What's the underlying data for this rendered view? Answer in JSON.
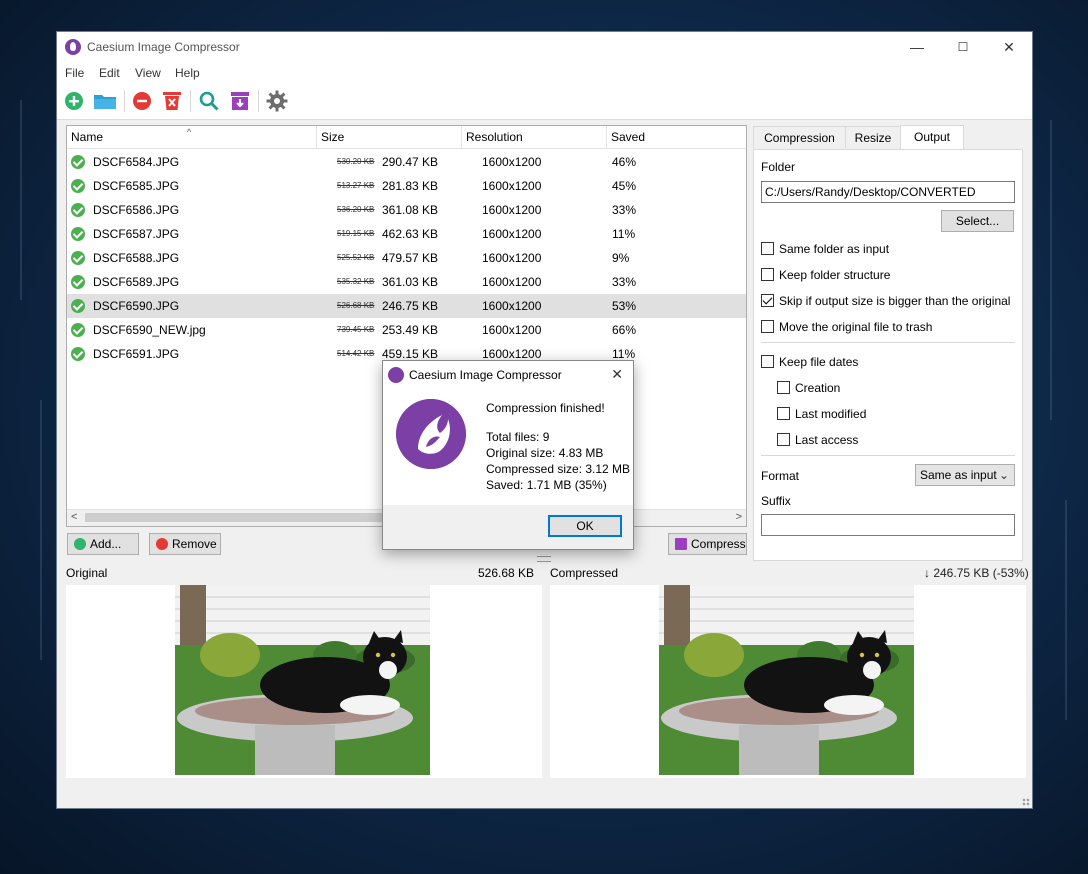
{
  "window": {
    "title": "Caesium Image Compressor",
    "controls": {
      "minimize": "—",
      "maximize": "☐",
      "close": "✕"
    }
  },
  "menu": [
    "File",
    "Edit",
    "View",
    "Help"
  ],
  "toolbar": {
    "icons": [
      "add-icon",
      "open-folder-icon",
      "remove-icon",
      "clear-list-icon",
      "search-icon",
      "compress-archive-icon",
      "settings-icon"
    ]
  },
  "file_list": {
    "columns": {
      "name": "Name",
      "size": "Size",
      "resolution": "Resolution",
      "saved": "Saved"
    },
    "rows": [
      {
        "name": "DSCF6584.JPG",
        "orig_size": "530.20 KB",
        "size": "290.47 KB",
        "resolution": "1600x1200",
        "saved": "46%",
        "selected": false
      },
      {
        "name": "DSCF6585.JPG",
        "orig_size": "513.27 KB",
        "size": "281.83 KB",
        "resolution": "1600x1200",
        "saved": "45%",
        "selected": false
      },
      {
        "name": "DSCF6586.JPG",
        "orig_size": "536.20 KB",
        "size": "361.08 KB",
        "resolution": "1600x1200",
        "saved": "33%",
        "selected": false
      },
      {
        "name": "DSCF6587.JPG",
        "orig_size": "519.15 KB",
        "size": "462.63 KB",
        "resolution": "1600x1200",
        "saved": "11%",
        "selected": false
      },
      {
        "name": "DSCF6588.JPG",
        "orig_size": "525.52 KB",
        "size": "479.57 KB",
        "resolution": "1600x1200",
        "saved": "9%",
        "selected": false
      },
      {
        "name": "DSCF6589.JPG",
        "orig_size": "535.32 KB",
        "size": "361.03 KB",
        "resolution": "1600x1200",
        "saved": "33%",
        "selected": false
      },
      {
        "name": "DSCF6590.JPG",
        "orig_size": "526.68 KB",
        "size": "246.75 KB",
        "resolution": "1600x1200",
        "saved": "53%",
        "selected": true
      },
      {
        "name": "DSCF6590_NEW.jpg",
        "orig_size": "739.45 KB",
        "size": "253.49 KB",
        "resolution": "1600x1200",
        "saved": "66%",
        "selected": false
      },
      {
        "name": "DSCF6591.JPG",
        "orig_size": "514.42 KB",
        "size": "459.15 KB",
        "resolution": "1600x1200",
        "saved": "11%",
        "selected": false
      }
    ]
  },
  "buttons": {
    "add": "Add...",
    "remove": "Remove",
    "compress": "Compress"
  },
  "tabs": {
    "compression": "Compression",
    "resize": "Resize",
    "output": "Output",
    "active": "Output"
  },
  "output": {
    "folder_label": "Folder",
    "folder_value": "C:/Users/Randy/Desktop/CONVERTED",
    "select_button": "Select...",
    "same_folder": {
      "label": "Same folder as input",
      "checked": false
    },
    "keep_structure": {
      "label": "Keep folder structure",
      "checked": false
    },
    "skip_bigger": {
      "label": "Skip if output size is bigger than the original",
      "checked": true
    },
    "move_trash": {
      "label": "Move the original file to trash",
      "checked": false
    },
    "keep_dates": {
      "label": "Keep file dates",
      "checked": false
    },
    "creation": {
      "label": "Creation",
      "checked": false
    },
    "last_modified": {
      "label": "Last modified",
      "checked": false
    },
    "last_access": {
      "label": "Last access",
      "checked": false
    },
    "format_label": "Format",
    "format_value": "Same as input",
    "suffix_label": "Suffix",
    "suffix_value": ""
  },
  "preview": {
    "original_label": "Original",
    "original_size": "526.68 KB",
    "compressed_label": "Compressed",
    "compressed_size": "↓ 246.75 KB (-53%)"
  },
  "dialog": {
    "title": "Caesium Image Compressor",
    "heading": "Compression finished!",
    "total_files": "Total files: 9",
    "original_size": "Original size: 4.83 MB",
    "compressed_size": "Compressed size: 3.12 MB",
    "saved": "Saved: 1.71 MB (35%)",
    "ok": "OK",
    "close": "✕"
  },
  "colors": {
    "brand_purple": "#7b3fa5",
    "success_green": "#4caf50",
    "remove_red": "#e53935",
    "accent_blue": "#0078d7"
  }
}
